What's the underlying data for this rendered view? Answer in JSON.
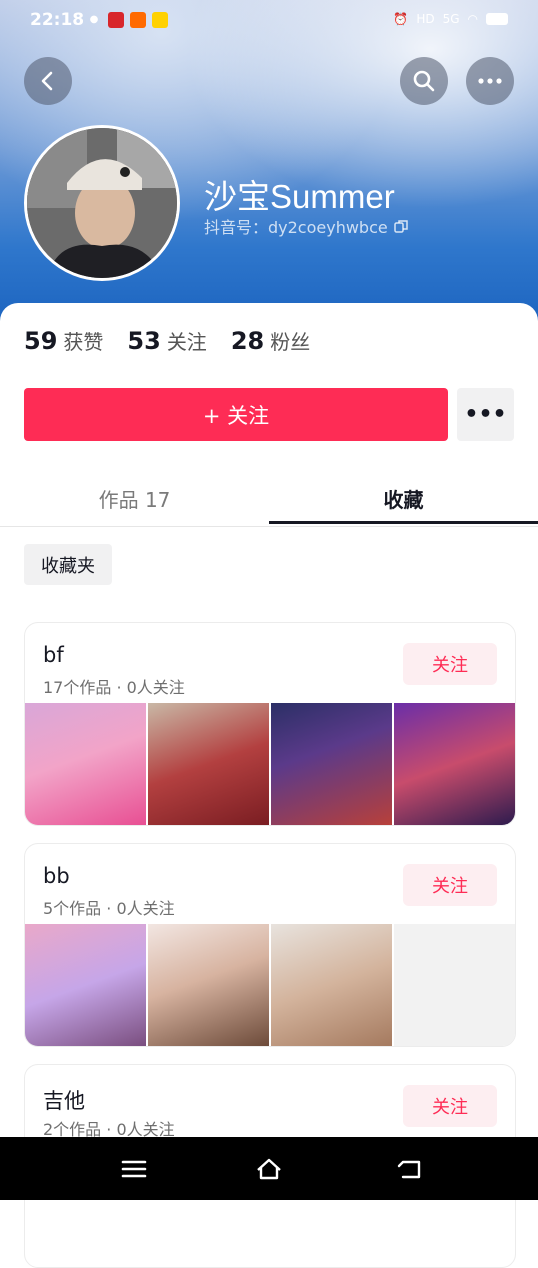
{
  "status_bar": {
    "time": "22:18",
    "network": "5G",
    "hd": "HD"
  },
  "profile": {
    "name": "沙宝Summer",
    "douyin_id": "抖音号：dy2coeyhwbce",
    "stats": [
      {
        "value": "59",
        "label": "获赞"
      },
      {
        "value": "53",
        "label": "关注"
      },
      {
        "value": "28",
        "label": "粉丝"
      }
    ],
    "follow_label": "+ 关注",
    "more_label": "•••"
  },
  "tabs": [
    {
      "label": "作品 17",
      "active": false
    },
    {
      "label": "收藏",
      "active": true
    }
  ],
  "folder_chip": "收藏夹",
  "collections": [
    {
      "title": "bf",
      "meta": "17个作品 · 0人关注",
      "follow": "关注"
    },
    {
      "title": "bb",
      "meta": "5个作品 · 0人关注",
      "follow": "关注"
    },
    {
      "title": "吉他",
      "meta": "2个作品 · 0人关注",
      "follow": "关注"
    }
  ],
  "colors": {
    "accent": "#fe2c55",
    "header": "#2f77cc"
  }
}
